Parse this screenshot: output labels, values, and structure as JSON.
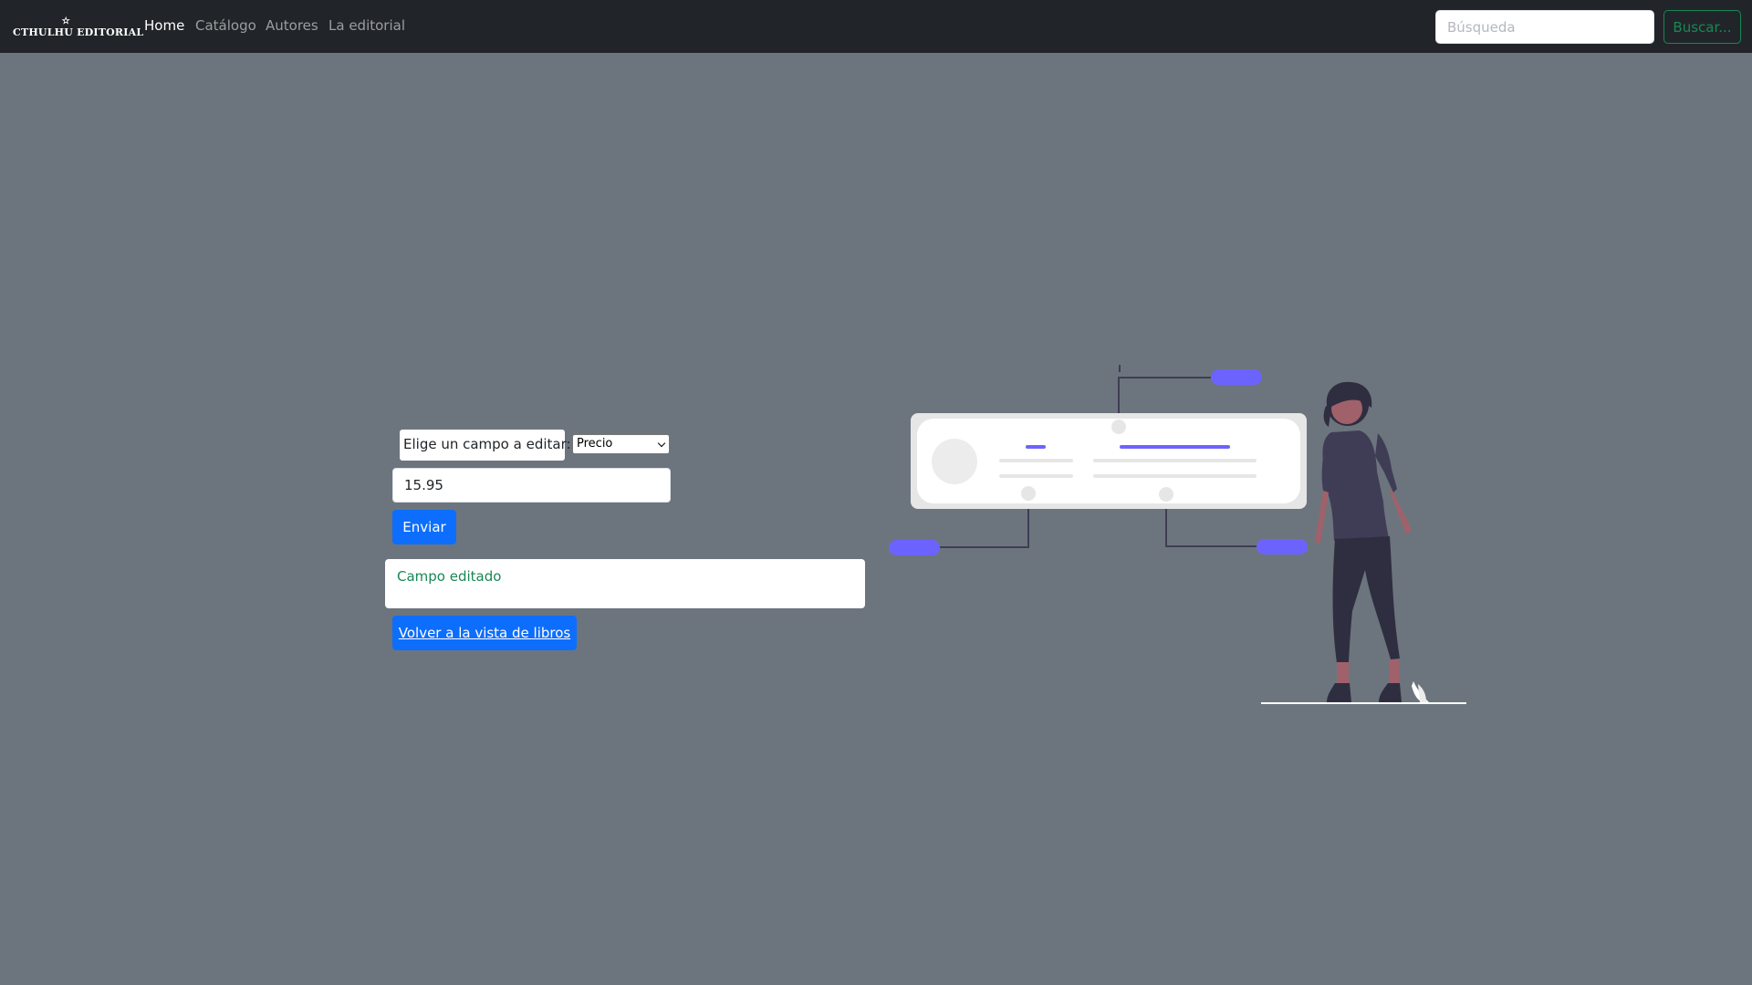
{
  "navbar": {
    "brand": "CTHULHU EDITORIAL",
    "brand_mark": "✫",
    "links": [
      {
        "label": "Home",
        "active": true
      },
      {
        "label": "Catálogo",
        "active": false
      },
      {
        "label": "Autores",
        "active": false
      },
      {
        "label": "La editorial",
        "active": false
      }
    ],
    "search": {
      "placeholder": "Búsqueda",
      "value": "",
      "button_label": "Buscar..."
    }
  },
  "form": {
    "field_label": "Elige un campo a editar:",
    "selected_field": "Precio",
    "value": "15.95",
    "submit_label": "Enviar"
  },
  "status": {
    "message": "Campo editado"
  },
  "back_link": {
    "label": "Volver a la vista de libros"
  },
  "colors": {
    "navbar_bg": "#212529",
    "page_bg": "#6c757d",
    "primary": "#0d6efd",
    "success": "#198754",
    "accent": "#6c63ff"
  }
}
